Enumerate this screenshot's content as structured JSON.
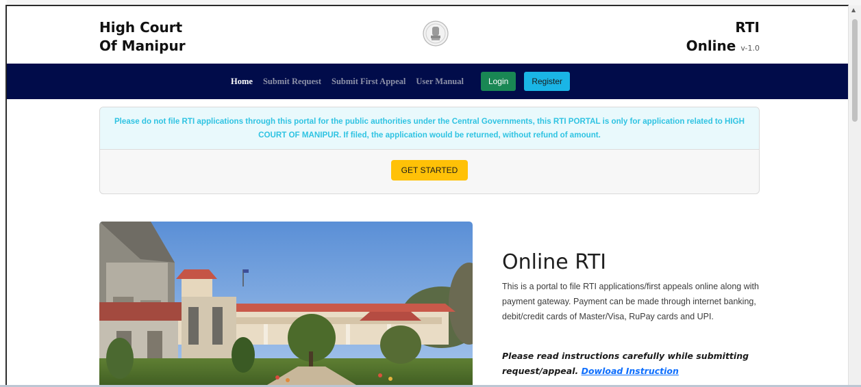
{
  "header": {
    "brand_line1": "High Court",
    "brand_line2": "Of Manipur",
    "emblem_icon": "national-emblem-icon",
    "rti_line1": "RTI",
    "rti_line2": "Online",
    "version": "v-1.0"
  },
  "nav": {
    "items": [
      {
        "label": "Home",
        "active": true
      },
      {
        "label": "Submit Request",
        "active": false
      },
      {
        "label": "Submit First Appeal",
        "active": false
      },
      {
        "label": "User Manual",
        "active": false
      }
    ],
    "login_label": "Login",
    "register_label": "Register",
    "colors": {
      "navbar_bg": "#010c4a",
      "login_bg": "#198754",
      "register_bg": "#1ab5e6"
    }
  },
  "notice": {
    "text": "Please do not file RTI applications through this portal for the public authorities under the Central Governments, this RTI PORTAL is only for application related to HIGH COURT OF MANIPUR. If filed, the application would be returned, without refund of amount.",
    "get_started_label": "GET STARTED",
    "colors": {
      "text": "#2fc3e2",
      "button_bg": "#ffc107"
    }
  },
  "main": {
    "photo_icon": "high-court-building-photo",
    "heading": "Online RTI",
    "description": "This is a portal to file RTI applications/first appeals online along with payment gateway. Payment can be made through internet banking, debit/credit cards of Master/Visa, RuPay cards and UPI.",
    "instruction_text": "Please read instructions carefully while submitting request/appeal.",
    "instruction_link": "Dowload Instruction"
  }
}
